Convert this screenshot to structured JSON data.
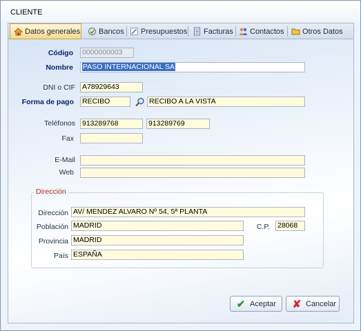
{
  "window": {
    "title": "CLIENTE"
  },
  "tabs": [
    {
      "label": "Datos generales",
      "icon": "house-icon"
    },
    {
      "label": "Bancos",
      "icon": "bank-icon"
    },
    {
      "label": "Presupuestos",
      "icon": "pencil-icon"
    },
    {
      "label": "Facturas",
      "icon": "invoice-icon"
    },
    {
      "label": "Contactos",
      "icon": "people-icon"
    },
    {
      "label": "Otros Datos",
      "icon": "folder-icon"
    }
  ],
  "form": {
    "codigo_label": "Código",
    "codigo": "0000000003",
    "nombre_label": "Nombre",
    "nombre": "PASO INTERNACIONAL SA",
    "dni_label": "DNI o CIF",
    "dni": "A78929643",
    "forma_pago_label": "Forma de pago",
    "forma_pago_code": "RECIBO",
    "forma_pago_desc": "RECIBO A LA VISTA",
    "telefonos_label": "Teléfonos",
    "telefono1": "913289768",
    "telefono2": "913289769",
    "fax_label": "Fax",
    "fax": "",
    "email_label": "E-Mail",
    "email": "",
    "web_label": "Web",
    "web": ""
  },
  "direccion": {
    "group_label": "Dirección",
    "direccion_label": "Dirección",
    "direccion": "AV/ MENDEZ ALVARO Nº 54, 5ª PLANTA",
    "poblacion_label": "Población",
    "poblacion": "MADRID",
    "cp_label": "C.P.",
    "cp": "28068",
    "provincia_label": "Provincia",
    "provincia": "MADRID",
    "pais_label": "País",
    "pais": "ESPAÑA"
  },
  "buttons": {
    "accept": "Aceptar",
    "cancel": "Cancelar"
  }
}
